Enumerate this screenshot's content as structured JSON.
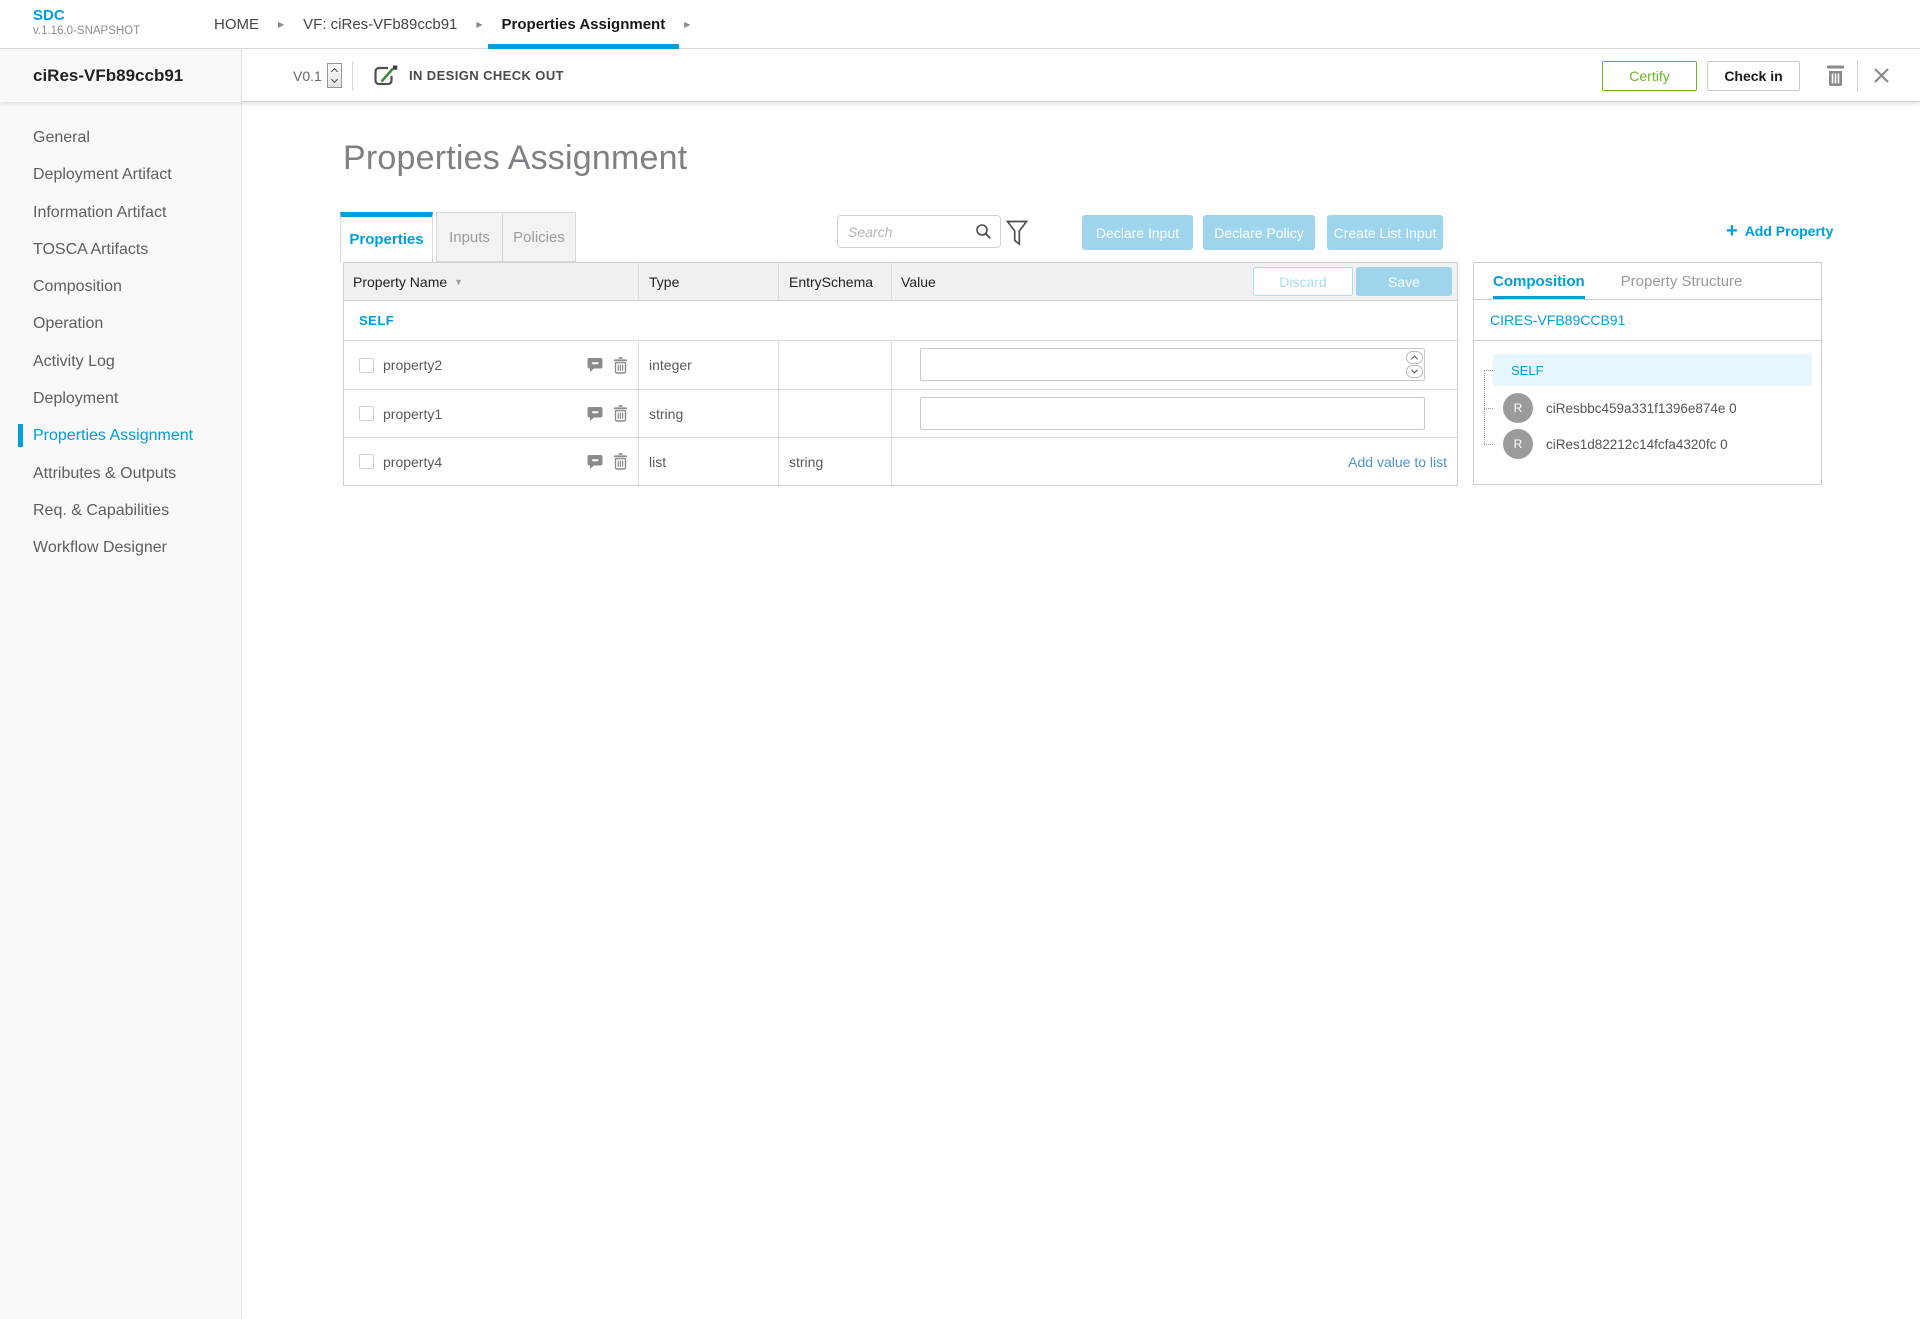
{
  "brand": {
    "name": "SDC",
    "version": "v.1.16.0-SNAPSHOT"
  },
  "breadcrumbs": [
    {
      "label": "HOME"
    },
    {
      "label": "VF: ciRes-VFb89ccb91"
    },
    {
      "label": "Properties Assignment"
    }
  ],
  "resource": {
    "name": "ciRes-VFb89ccb91",
    "version": "V0.1",
    "status": "IN DESIGN CHECK OUT"
  },
  "toolbar": {
    "certify_label": "Certify",
    "checkin_label": "Check in"
  },
  "sidebar": {
    "items": [
      {
        "label": "General"
      },
      {
        "label": "Deployment Artifact"
      },
      {
        "label": "Information Artifact"
      },
      {
        "label": "TOSCA Artifacts"
      },
      {
        "label": "Composition"
      },
      {
        "label": "Operation"
      },
      {
        "label": "Activity Log"
      },
      {
        "label": "Deployment"
      },
      {
        "label": "Properties Assignment"
      },
      {
        "label": "Attributes & Outputs"
      },
      {
        "label": "Req. & Capabilities"
      },
      {
        "label": "Workflow Designer"
      }
    ]
  },
  "page": {
    "title": "Properties Assignment"
  },
  "tabs": [
    {
      "label": "Properties"
    },
    {
      "label": "Inputs"
    },
    {
      "label": "Policies"
    }
  ],
  "controls": {
    "search_placeholder": "Search",
    "declare_input_label": "Declare Input",
    "declare_policy_label": "Declare Policy",
    "create_list_input_label": "Create List Input",
    "plus": "+",
    "add_property_label": "Add Property"
  },
  "table": {
    "headers": {
      "name": "Property Name",
      "type": "Type",
      "entry_schema": "EntrySchema",
      "value": "Value"
    },
    "sort_arrow": "▼",
    "discard_label": "Discard",
    "save_label": "Save",
    "group_label": "SELF",
    "rows": [
      {
        "name": "property2",
        "type": "integer",
        "entry_schema": "",
        "value": ""
      },
      {
        "name": "property1",
        "type": "string",
        "entry_schema": "",
        "value": ""
      },
      {
        "name": "property4",
        "type": "list",
        "entry_schema": "string",
        "value_link": "Add value to list"
      }
    ]
  },
  "composition": {
    "tabs": [
      {
        "label": "Composition"
      },
      {
        "label": "Property Structure"
      }
    ],
    "root_label": "CIRES-VFB89CCB91",
    "self_label": "SELF",
    "instances": [
      {
        "initial": "R",
        "name": "ciResbbc459a331f1396e874e 0"
      },
      {
        "initial": "R",
        "name": "ciRes1d82212c14fcfa4320fc 0"
      }
    ]
  },
  "colors": {
    "primary": "#009fdb",
    "action_disabled_blue": "#9ed5ec",
    "certify_green": "#6cb52b",
    "link_blue": "#4f93c9"
  }
}
